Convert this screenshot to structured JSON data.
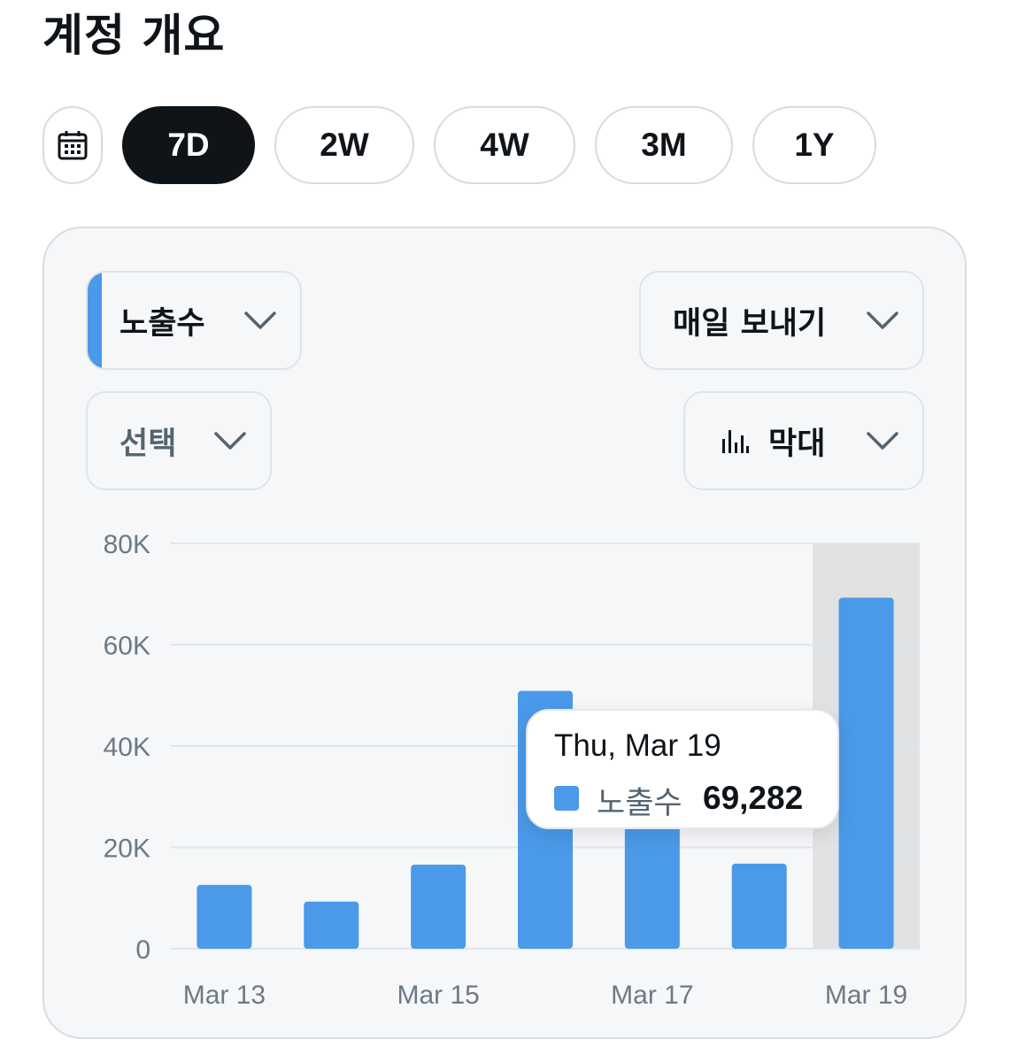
{
  "header": {
    "title": "계정 개요"
  },
  "range": {
    "calendar_icon": "calendar-icon",
    "options": [
      "7D",
      "2W",
      "4W",
      "3M",
      "1Y"
    ],
    "selected": "7D"
  },
  "controls": {
    "metric": "노출수",
    "frequency": "매일 보내기",
    "compare": "선택",
    "chart_type": "막대",
    "chart_type_icon": "bar-chart-icon"
  },
  "colors": {
    "accent": "#4b99e9",
    "highlight_band": "#e1e2e3",
    "selected_button": "#0f1419"
  },
  "tooltip": {
    "date": "Thu, Mar 19",
    "series": "노출수",
    "value": "69,282"
  },
  "chart_data": {
    "type": "bar",
    "categories": [
      "Mar 13",
      "Mar 14",
      "Mar 15",
      "Mar 16",
      "Mar 17",
      "Mar 18",
      "Mar 19"
    ],
    "x_tick_labels": [
      "Mar 13",
      "Mar 15",
      "Mar 17",
      "Mar 19"
    ],
    "series": [
      {
        "name": "노출수",
        "values": [
          12600,
          9300,
          16600,
          50900,
          26000,
          16800,
          69282
        ]
      }
    ],
    "y_ticks": [
      0,
      20000,
      40000,
      60000,
      80000
    ],
    "y_tick_labels": [
      "0",
      "20K",
      "40K",
      "60K",
      "80K"
    ],
    "ylim": [
      0,
      80000
    ],
    "grid": true,
    "highlighted_category": "Mar 19"
  }
}
